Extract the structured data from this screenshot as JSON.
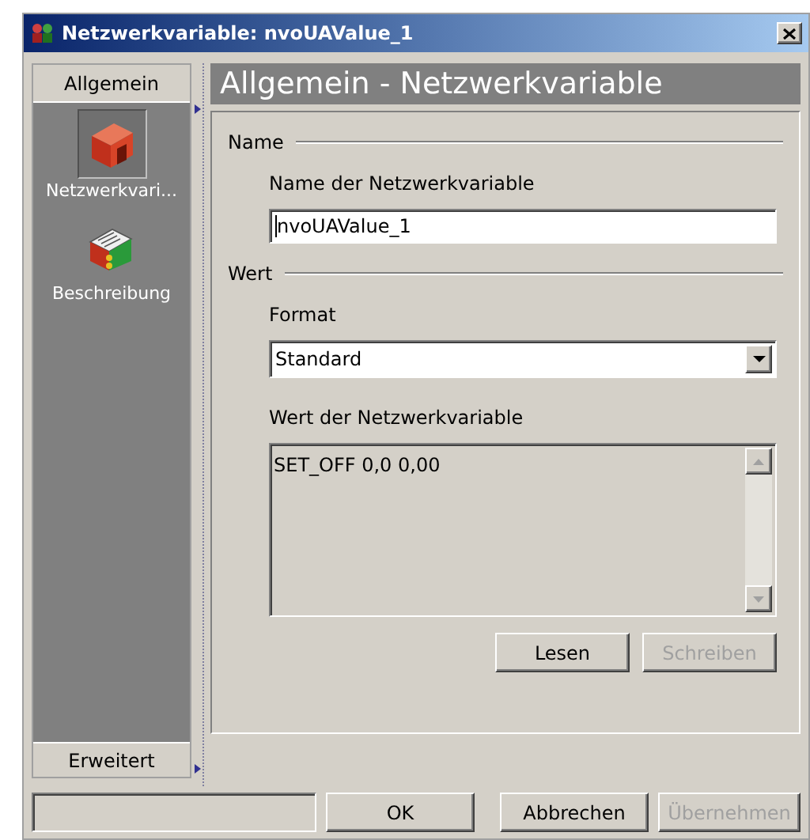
{
  "window": {
    "title": "Netzwerkvariable: nvoUAValue_1"
  },
  "sidebar": {
    "top_button": "Allgemein",
    "items": [
      {
        "label": "Netzwerkvari...",
        "selected": true,
        "kind": "variable"
      },
      {
        "label": "Beschreibung",
        "selected": false,
        "kind": "description"
      }
    ],
    "bottom_button": "Erweitert"
  },
  "panel": {
    "title": "Allgemein - Netzwerkvariable",
    "name_group": {
      "legend": "Name",
      "label": "Name der Netzwerkvariable",
      "value": "nvoUAValue_1"
    },
    "value_group": {
      "legend": "Wert",
      "format_label": "Format",
      "format_value": "Standard",
      "value_label": "Wert der Netzwerkvariable",
      "value_text": "SET_OFF 0,0 0,00",
      "buttons": [
        {
          "label": "Lesen",
          "disabled": false
        },
        {
          "label": "Schreiben",
          "disabled": true
        }
      ]
    }
  },
  "footer": {
    "buttons": [
      {
        "label": "OK",
        "disabled": false
      },
      {
        "label": "Abbrechen",
        "disabled": false
      },
      {
        "label": "Übernehmen",
        "disabled": true
      }
    ]
  }
}
